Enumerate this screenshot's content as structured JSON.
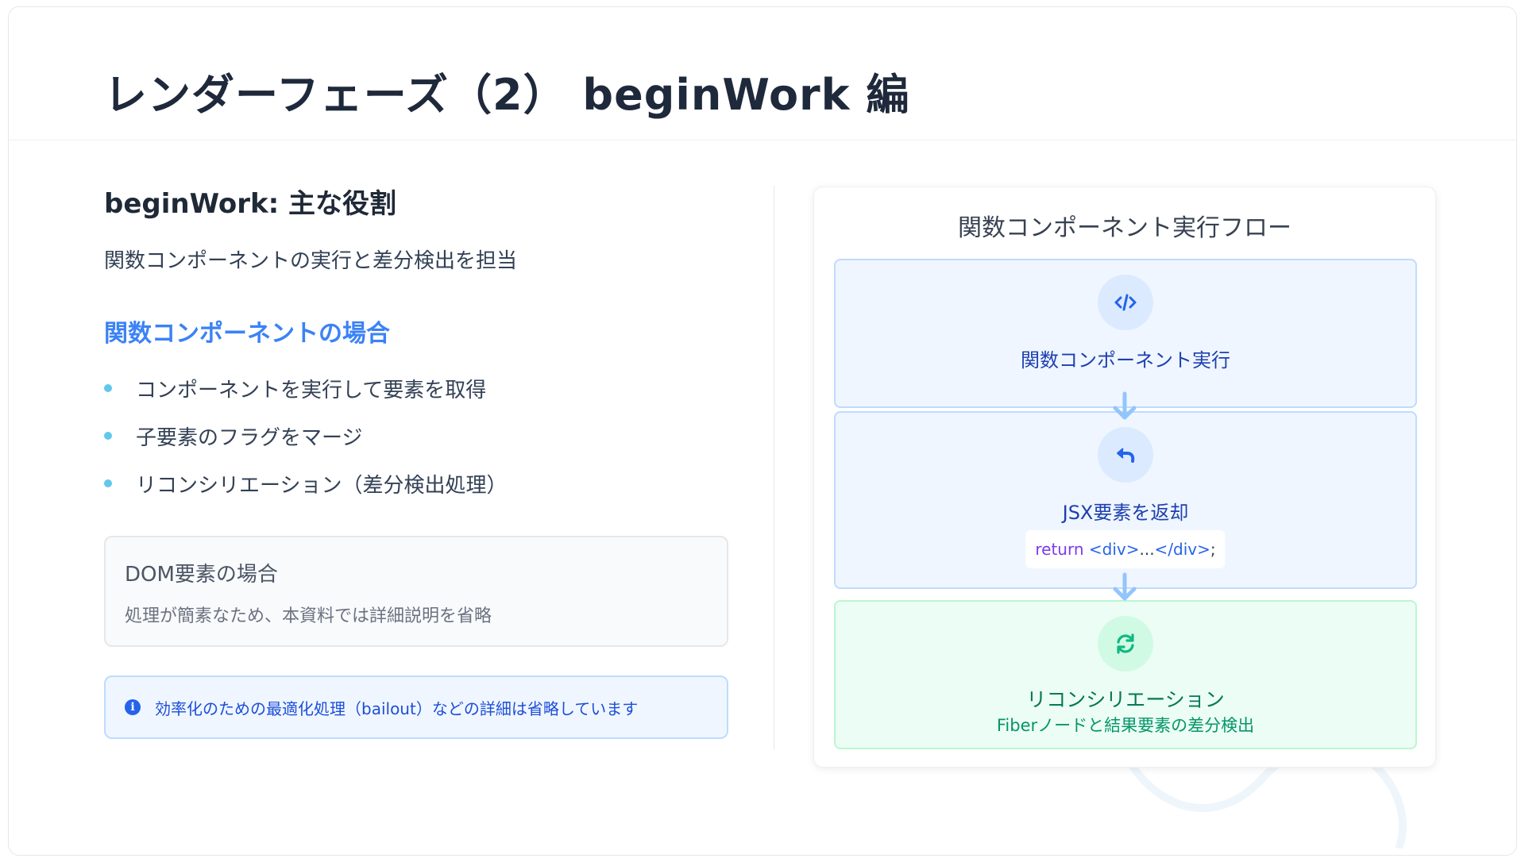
{
  "slide": {
    "title": "レンダーフェーズ（2） beginWork 編"
  },
  "left": {
    "role_heading": "beginWork: 主な役割",
    "role_desc": "関数コンポーネントの実行と差分検出を担当",
    "func_heading": "関数コンポーネントの場合",
    "bullets": [
      "コンポーネントを実行して要素を取得",
      "子要素のフラグをマージ",
      "リコンシリエーション（差分検出処理）"
    ],
    "dom_box": {
      "title": "DOM要素の場合",
      "desc": "処理が簡素なため、本資料では詳細説明を省略"
    },
    "info_box": {
      "icon": "info-icon",
      "text": "効率化のための最適化処理（bailout）などの詳細は省略しています"
    }
  },
  "flow": {
    "title": "関数コンポーネント実行フロー",
    "steps": [
      {
        "icon": "code-icon",
        "label": "関数コンポーネント実行"
      },
      {
        "icon": "reply-arrow-icon",
        "label": "JSX要素を返却",
        "code": {
          "keyword": "return",
          "open_tag": " <div>",
          "dots": "...",
          "close_tag": "</div>",
          "end": ";"
        }
      },
      {
        "icon": "sync-icon",
        "label": "リコンシリエーション",
        "sub": "Fiberノードと結果要素の差分検出"
      }
    ]
  },
  "colors": {
    "accent_blue": "#3b82f6",
    "bullet_dot": "#60c8ec",
    "step_blue_bg": "#eff6ff",
    "step_green_bg": "#ecfdf5",
    "text_green": "#059669"
  }
}
